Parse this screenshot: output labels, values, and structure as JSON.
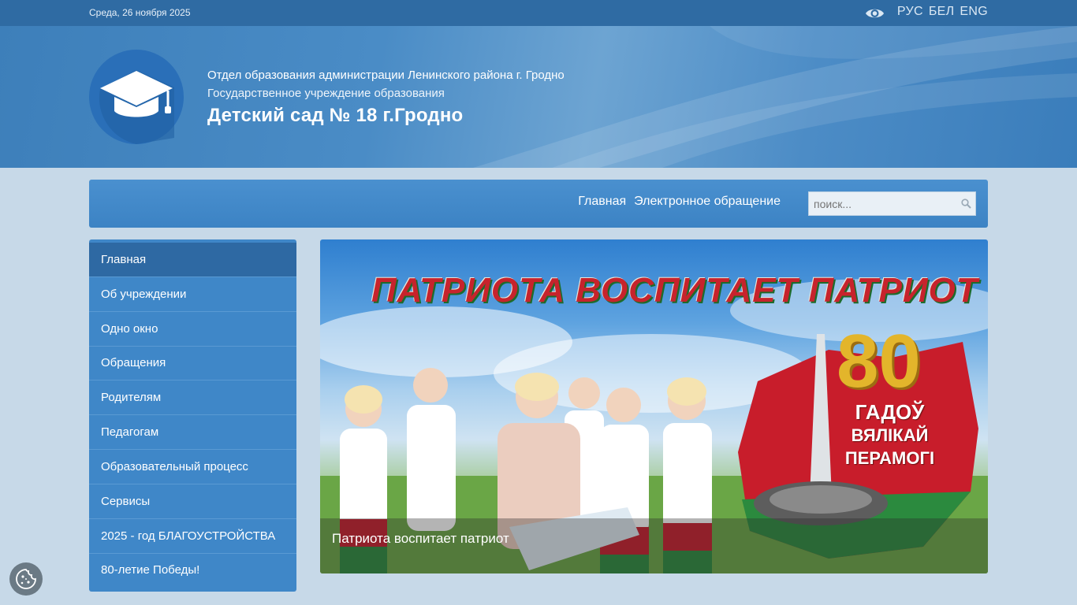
{
  "topbar": {
    "date": "Среда, 26 ноября 2025",
    "accessibility_icon": "eye-icon",
    "languages": [
      "РУС",
      "БЕЛ",
      "ENG"
    ]
  },
  "header": {
    "org_line1": "Отдел образования администрации Ленинского района г. Гродно",
    "org_line2": "Государственное учреждение образования",
    "title": "Детский сад № 18 г.Гродно",
    "logo_icon": "graduation-cap-icon"
  },
  "nav": {
    "links": [
      "Главная",
      "Электронное обращение"
    ],
    "search_placeholder": "поиск...",
    "search_icon": "search-icon"
  },
  "sidebar": {
    "items": [
      {
        "label": "Главная",
        "active": true
      },
      {
        "label": "Об учреждении"
      },
      {
        "label": "Одно окно"
      },
      {
        "label": "Обращения"
      },
      {
        "label": "Родителям"
      },
      {
        "label": "Педагогам"
      },
      {
        "label": "Образовательный процесс"
      },
      {
        "label": "Сервисы"
      },
      {
        "label": "2025 - год БЛАГОУСТРОЙСТВА"
      },
      {
        "label": "80-летие Победы!"
      }
    ]
  },
  "banner": {
    "slogan": "ПАТРИОТА ВОСПИТАЕТ ПАТРИОТ",
    "number": "80",
    "anniversary_line1": "ГАДОЎ",
    "anniversary_line2": "ВЯЛІКАЙ",
    "anniversary_line3": "ПЕРАМОГІ",
    "caption": "Патриота воспитает патриот"
  },
  "cookie": {
    "icon": "cookie-icon"
  },
  "colors": {
    "topbar": "#2f6ba3",
    "accent": "#3f87c8",
    "active_item": "#2e69a3",
    "page_bg": "#c7d9e8"
  }
}
